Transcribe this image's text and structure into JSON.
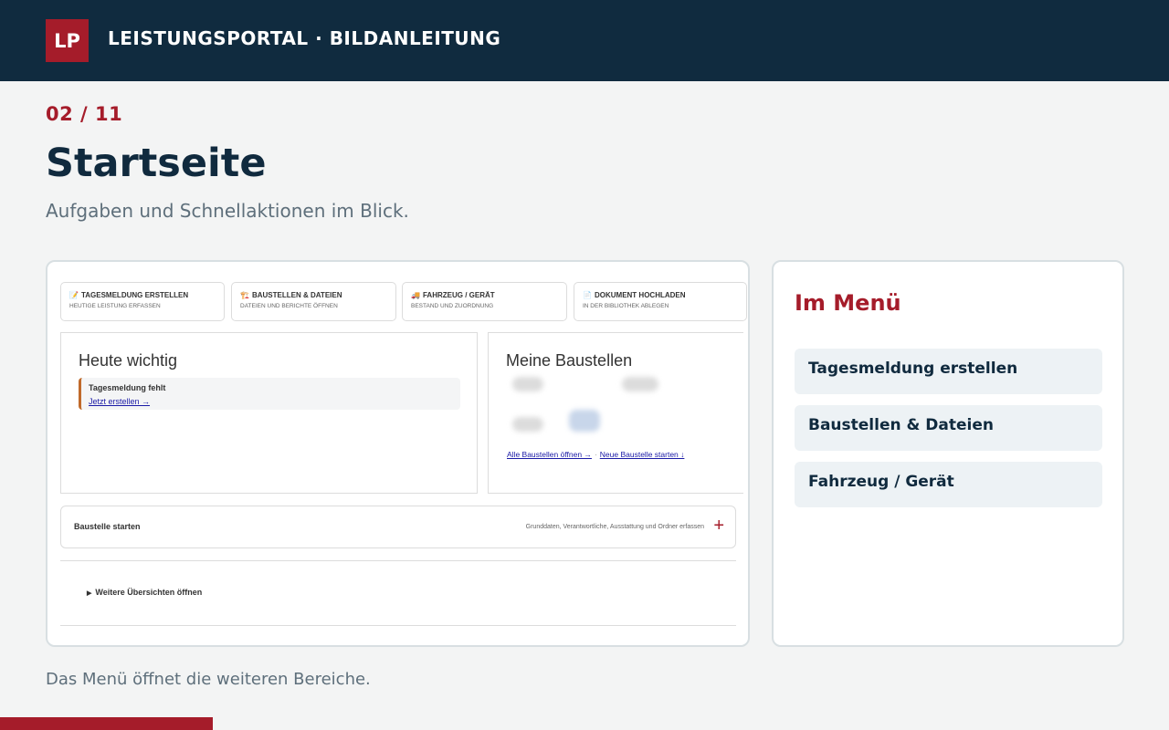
{
  "header": {
    "logo_text": "LP",
    "title": "LEISTUNGSPORTAL · BILDANLEITUNG"
  },
  "step": {
    "counter": "02 / 11",
    "current": 2,
    "total": 11
  },
  "page": {
    "title": "Startseite",
    "subtitle": "Aufgaben und Schnellaktionen im Blick."
  },
  "screenshot": {
    "quick_actions": [
      {
        "icon": "📝",
        "title": "TAGESMELDUNG ERSTELLEN",
        "subtitle": "HEUTIGE LEISTUNG ERFASSEN"
      },
      {
        "icon": "🏗️",
        "title": "BAUSTELLEN & DATEIEN",
        "subtitle": "DATEIEN UND BERICHTE ÖFFNEN"
      },
      {
        "icon": "🚚",
        "title": "FAHRZEUG / GERÄT",
        "subtitle": "BESTAND UND ZUORDNUNG"
      },
      {
        "icon": "📄",
        "title": "DOKUMENT HOCHLADEN",
        "subtitle": "IN DER BIBLIOTHEK ABLEGEN"
      }
    ],
    "today": {
      "heading": "Heute wichtig",
      "item_title": "Tagesmeldung fehlt",
      "item_link": "Jetzt erstellen →"
    },
    "sites": {
      "heading": "Meine Baustellen",
      "link_all": "Alle Baustellen öffnen →",
      "separator": "·",
      "link_new": "Neue Baustelle starten ↓"
    },
    "start_site": {
      "title": "Baustelle starten",
      "description": "Grunddaten, Verantwortliche, Ausstattung und Ordner erfassen",
      "plus": "+"
    },
    "more": {
      "label": "Weitere Übersichten öffnen",
      "marker": "▶"
    }
  },
  "menu": {
    "heading": "Im Menü",
    "items": [
      "Tagesmeldung erstellen",
      "Baustellen & Dateien",
      "Fahrzeug / Gerät"
    ]
  },
  "footer": {
    "text": "Das Menü öffnet die weiteren Bereiche."
  },
  "colors": {
    "brand": "#a51c2a",
    "navy": "#102b3f",
    "muted": "#5e6f7b"
  }
}
